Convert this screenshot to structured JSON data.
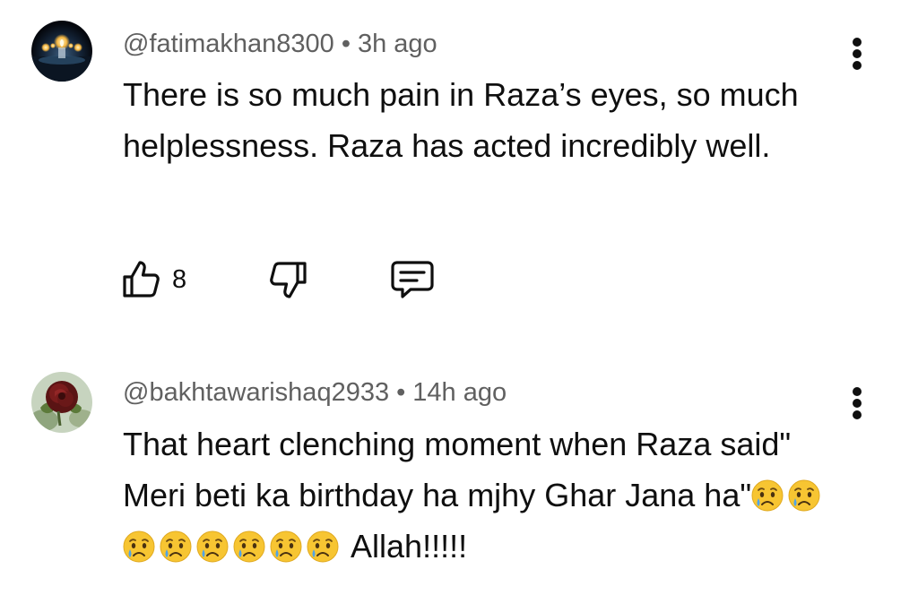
{
  "comments": [
    {
      "handle": "@fatimakhan8300",
      "separator": "•",
      "time": "3h ago",
      "text": "There is so much pain in Raza’s eyes, so much helplessness. Raza has acted incredibly well.",
      "like_count": "8",
      "avatar": "candle-avatar",
      "icons": [
        "thumbs-up-icon",
        "thumbs-down-icon",
        "reply-icon",
        "more-vert-icon"
      ]
    },
    {
      "handle": "@bakhtawarishaq2933",
      "separator": "•",
      "time": "14h ago",
      "text_before_emoji": "That heart clenching moment when Raza said\" Meri beti ka birthday ha mjhy Ghar Jana ha\"",
      "emoji_name": "crying-face-emoji",
      "emoji_count": 8,
      "text_after_emoji": "Allah!!!!!",
      "avatar": "rose-avatar",
      "icons": [
        "more-vert-icon"
      ]
    }
  ],
  "colors": {
    "text_primary": "#0f0f0f",
    "text_secondary": "#606060",
    "background": "#ffffff"
  }
}
